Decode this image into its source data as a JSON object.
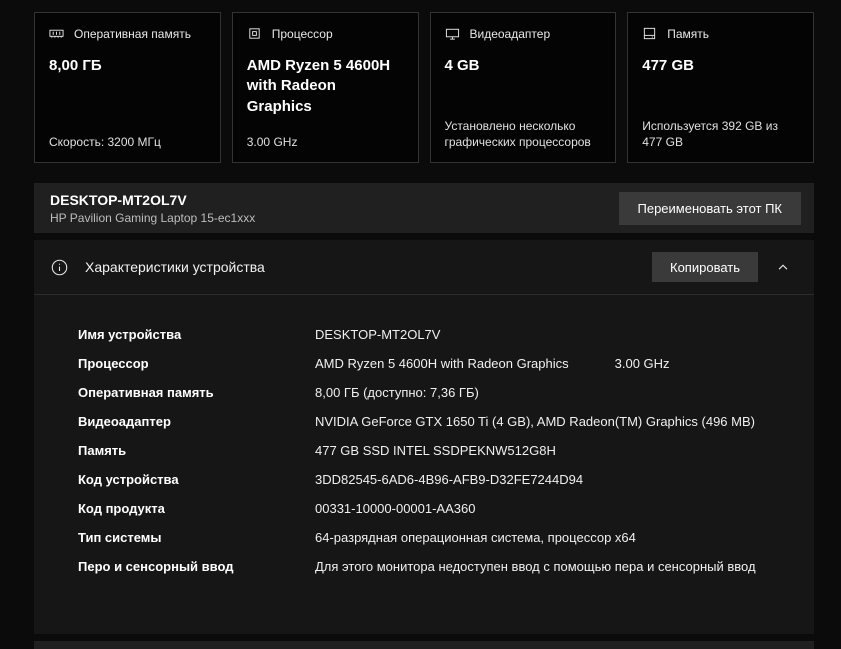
{
  "cards": [
    {
      "icon": "ram-icon",
      "title": "Оперативная память",
      "value": "8,00 ГБ",
      "footer": "Скорость: 3200 МГц"
    },
    {
      "icon": "cpu-icon",
      "title": "Процессор",
      "value": "AMD Ryzen 5 4600H with Radeon Graphics",
      "footer": "3.00 GHz"
    },
    {
      "icon": "gpu-icon",
      "title": "Видеоадаптер",
      "value": "4 GB",
      "footer": "Установлено несколько графических процессоров"
    },
    {
      "icon": "storage-icon",
      "title": "Память",
      "value": "477 GB",
      "footer": "Используется 392 GB из 477 GB"
    }
  ],
  "device": {
    "name": "DESKTOP-MT2OL7V",
    "model": "HP Pavilion Gaming Laptop 15-ec1xxx",
    "rename_button": "Переименовать этот ПК"
  },
  "specs": {
    "title": "Характеристики устройства",
    "copy_button": "Копировать",
    "chevron_icon": "chevron-up-icon",
    "info_icon": "info-icon",
    "rows": [
      {
        "label": "Имя устройства",
        "value": "DESKTOP-MT2OL7V"
      },
      {
        "label": "Процессор",
        "value": "AMD Ryzen 5 4600H with Radeon Graphics",
        "extra": "3.00 GHz"
      },
      {
        "label": "Оперативная память",
        "value": "8,00 ГБ (доступно: 7,36 ГБ)"
      },
      {
        "label": "Видеоадаптер",
        "value": "NVIDIA GeForce GTX 1650 Ti (4 GB), AMD Radeon(TM) Graphics (496 MB)"
      },
      {
        "label": "Память",
        "value": "477 GB SSD INTEL SSDPEKNW512G8H"
      },
      {
        "label": "Код устройства",
        "value": "3DD82545-6AD6-4B96-AFB9-D32FE7244D94"
      },
      {
        "label": "Код продукта",
        "value": "00331-10000-00001-AA360"
      },
      {
        "label": "Тип системы",
        "value": "64-разрядная операционная система, процессор x64"
      },
      {
        "label": "Перо и сенсорный ввод",
        "value": "Для этого монитора недоступен ввод с помощью пера и сенсорный ввод"
      }
    ]
  },
  "colors": {
    "page_bg": "#0b0b0b",
    "card_bg": "#040404",
    "card_border": "#333333",
    "bar_bg": "#202020",
    "panel_bg": "#161616",
    "button_bg": "#3a3a3a"
  }
}
